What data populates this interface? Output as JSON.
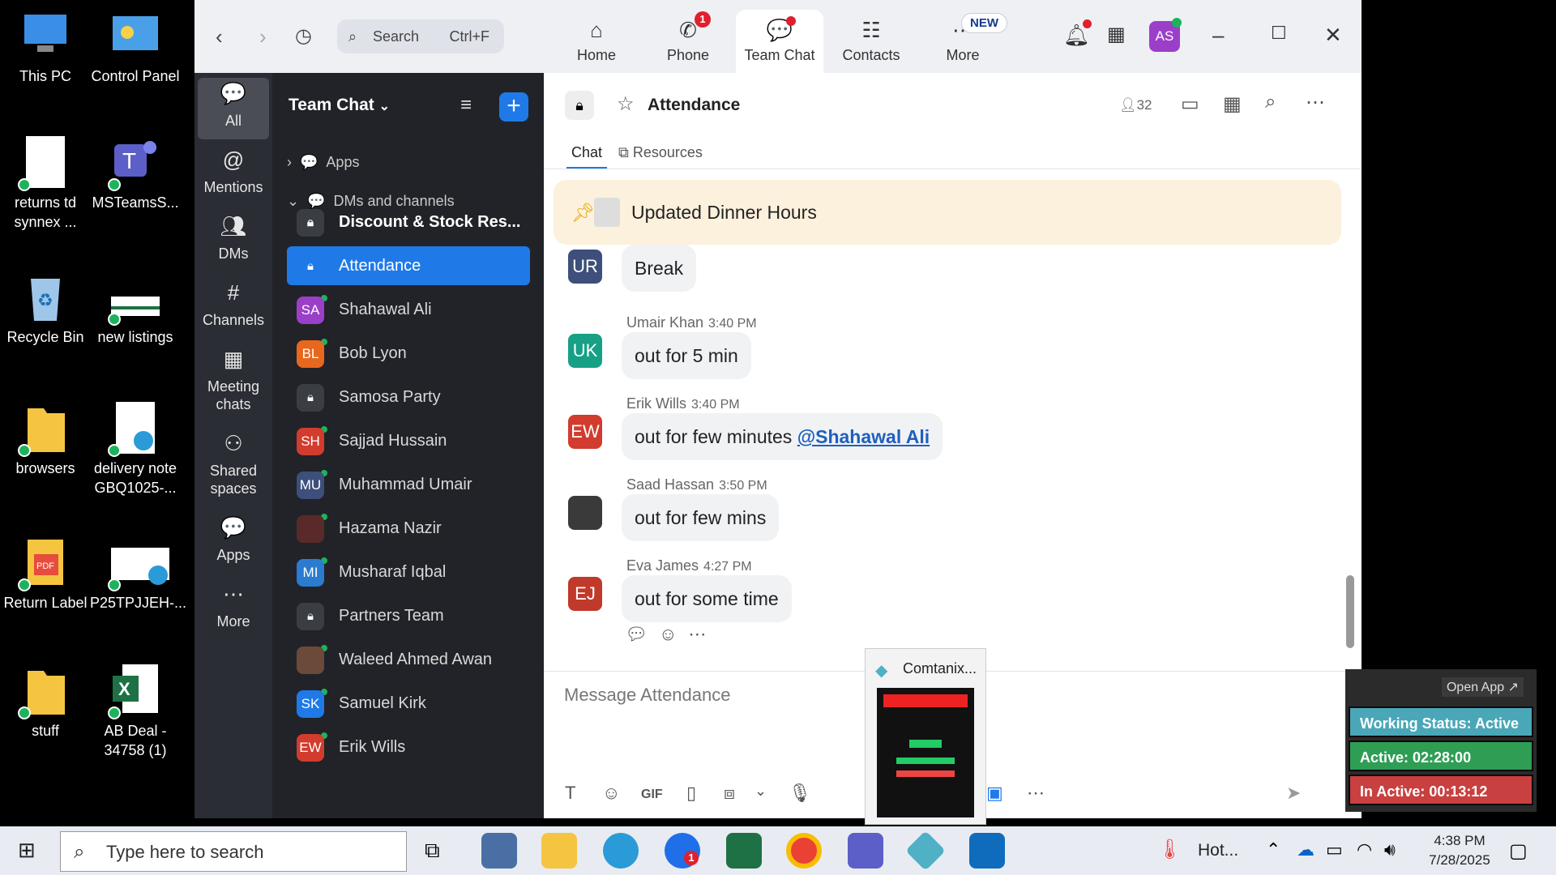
{
  "desktop": {
    "icons": [
      {
        "label": "This PC",
        "color": "#3a8ee6"
      },
      {
        "label": "Control Panel",
        "color": "#4aa0e8"
      },
      {
        "label": "returns td synnex ...",
        "color": "#ffffff"
      },
      {
        "label": "MSTeamsS...",
        "color": "#5b5fc7"
      },
      {
        "label": "Recycle Bin",
        "color": "#9ec6e8"
      },
      {
        "label": "new listings",
        "color": "#ffffff"
      },
      {
        "label": "browsers",
        "color": "#f5c542"
      },
      {
        "label": "delivery note GBQ1025-...",
        "color": "#ffffff"
      },
      {
        "label": "Return Label",
        "color": "#f5c542"
      },
      {
        "label": "P25TPJJEH-...",
        "color": "#ffffff"
      },
      {
        "label": "stuff",
        "color": "#f5c542"
      },
      {
        "label": "AB Deal - 34758 (1)",
        "color": "#1e7145"
      }
    ]
  },
  "titlebar": {
    "search_label": "Search",
    "search_shortcut": "Ctrl+F",
    "tabs": [
      {
        "label": "Home",
        "icon": "home-icon"
      },
      {
        "label": "Phone",
        "icon": "phone-icon",
        "badge": "1"
      },
      {
        "label": "Team Chat",
        "icon": "chat-icon"
      },
      {
        "label": "Contacts",
        "icon": "contacts-icon"
      },
      {
        "label": "More",
        "icon": "more-icon"
      }
    ],
    "new_badge": "NEW",
    "avatar": "AS"
  },
  "rail": [
    {
      "label": "All"
    },
    {
      "label": "Mentions"
    },
    {
      "label": "DMs"
    },
    {
      "label": "Channels"
    },
    {
      "label": "Meeting chats"
    },
    {
      "label": "Shared spaces"
    },
    {
      "label": "Apps"
    },
    {
      "label": "More"
    }
  ],
  "sidebar": {
    "title": "Team Chat",
    "sections": {
      "apps": "Apps",
      "dms": "DMs and channels"
    },
    "items": [
      {
        "label": "Discount & Stock Res...",
        "type": "channel"
      },
      {
        "label": "Attendance",
        "type": "channel"
      },
      {
        "label": "Shahawal Ali",
        "initials": "SA",
        "color": "#9b3fc9"
      },
      {
        "label": "Bob Lyon",
        "initials": "BL",
        "color": "#e8671e"
      },
      {
        "label": "Samosa Party",
        "type": "channel"
      },
      {
        "label": "Sajjad Hussain",
        "initials": "SH",
        "color": "#d13c2e"
      },
      {
        "label": "Muhammad Umair",
        "initials": "MU",
        "color": "#3d4f7a"
      },
      {
        "label": "Hazama Nazir",
        "initials": "",
        "color": "#5a2a2a"
      },
      {
        "label": "Musharaf Iqbal",
        "initials": "MI",
        "color": "#2b7bd1"
      },
      {
        "label": "Partners Team",
        "type": "channel"
      },
      {
        "label": "Waleed Ahmed Awan",
        "initials": "",
        "color": "#6b4a3a"
      },
      {
        "label": "Samuel Kirk",
        "initials": "SK",
        "color": "#1f7ae8"
      },
      {
        "label": "Erik Wills",
        "initials": "EW",
        "color": "#d13c2e"
      }
    ]
  },
  "chat": {
    "title": "Attendance",
    "member_count": "32",
    "tabs": {
      "chat": "Chat",
      "resources": "Resources"
    },
    "pinned": "Updated Dinner Hours",
    "messages": [
      {
        "initials": "UR",
        "color": "#3d4f7a",
        "name": "",
        "time": "",
        "text": "Break"
      },
      {
        "initials": "UK",
        "color": "#16a085",
        "name": "Umair Khan",
        "time": "3:40 PM",
        "text": "out for 5 min"
      },
      {
        "initials": "EW",
        "color": "#d13c2e",
        "name": "Erik Wills",
        "time": "3:40 PM",
        "text": "out for few minutes ",
        "mention": "@Shahawal Ali"
      },
      {
        "initials": "",
        "color": "#3a3a3a",
        "name": "Saad Hassan",
        "time": "3:50 PM",
        "text": "out for few mins"
      },
      {
        "initials": "EJ",
        "color": "#c0392b",
        "name": "Eva James",
        "time": "4:27 PM",
        "text": "out for some time"
      }
    ],
    "compose_placeholder": "Message Attendance"
  },
  "popup": {
    "title": "Comtanix..."
  },
  "widget": {
    "open_app": "Open App ↗",
    "working": "Working Status: Active",
    "active": "Active: 02:28:00",
    "inactive": "In Active: 00:13:12"
  },
  "taskbar": {
    "search": "Type here to search",
    "weather": "Hot...",
    "time": "4:38 PM",
    "date": "7/28/2025",
    "zoom_badge": "1"
  }
}
